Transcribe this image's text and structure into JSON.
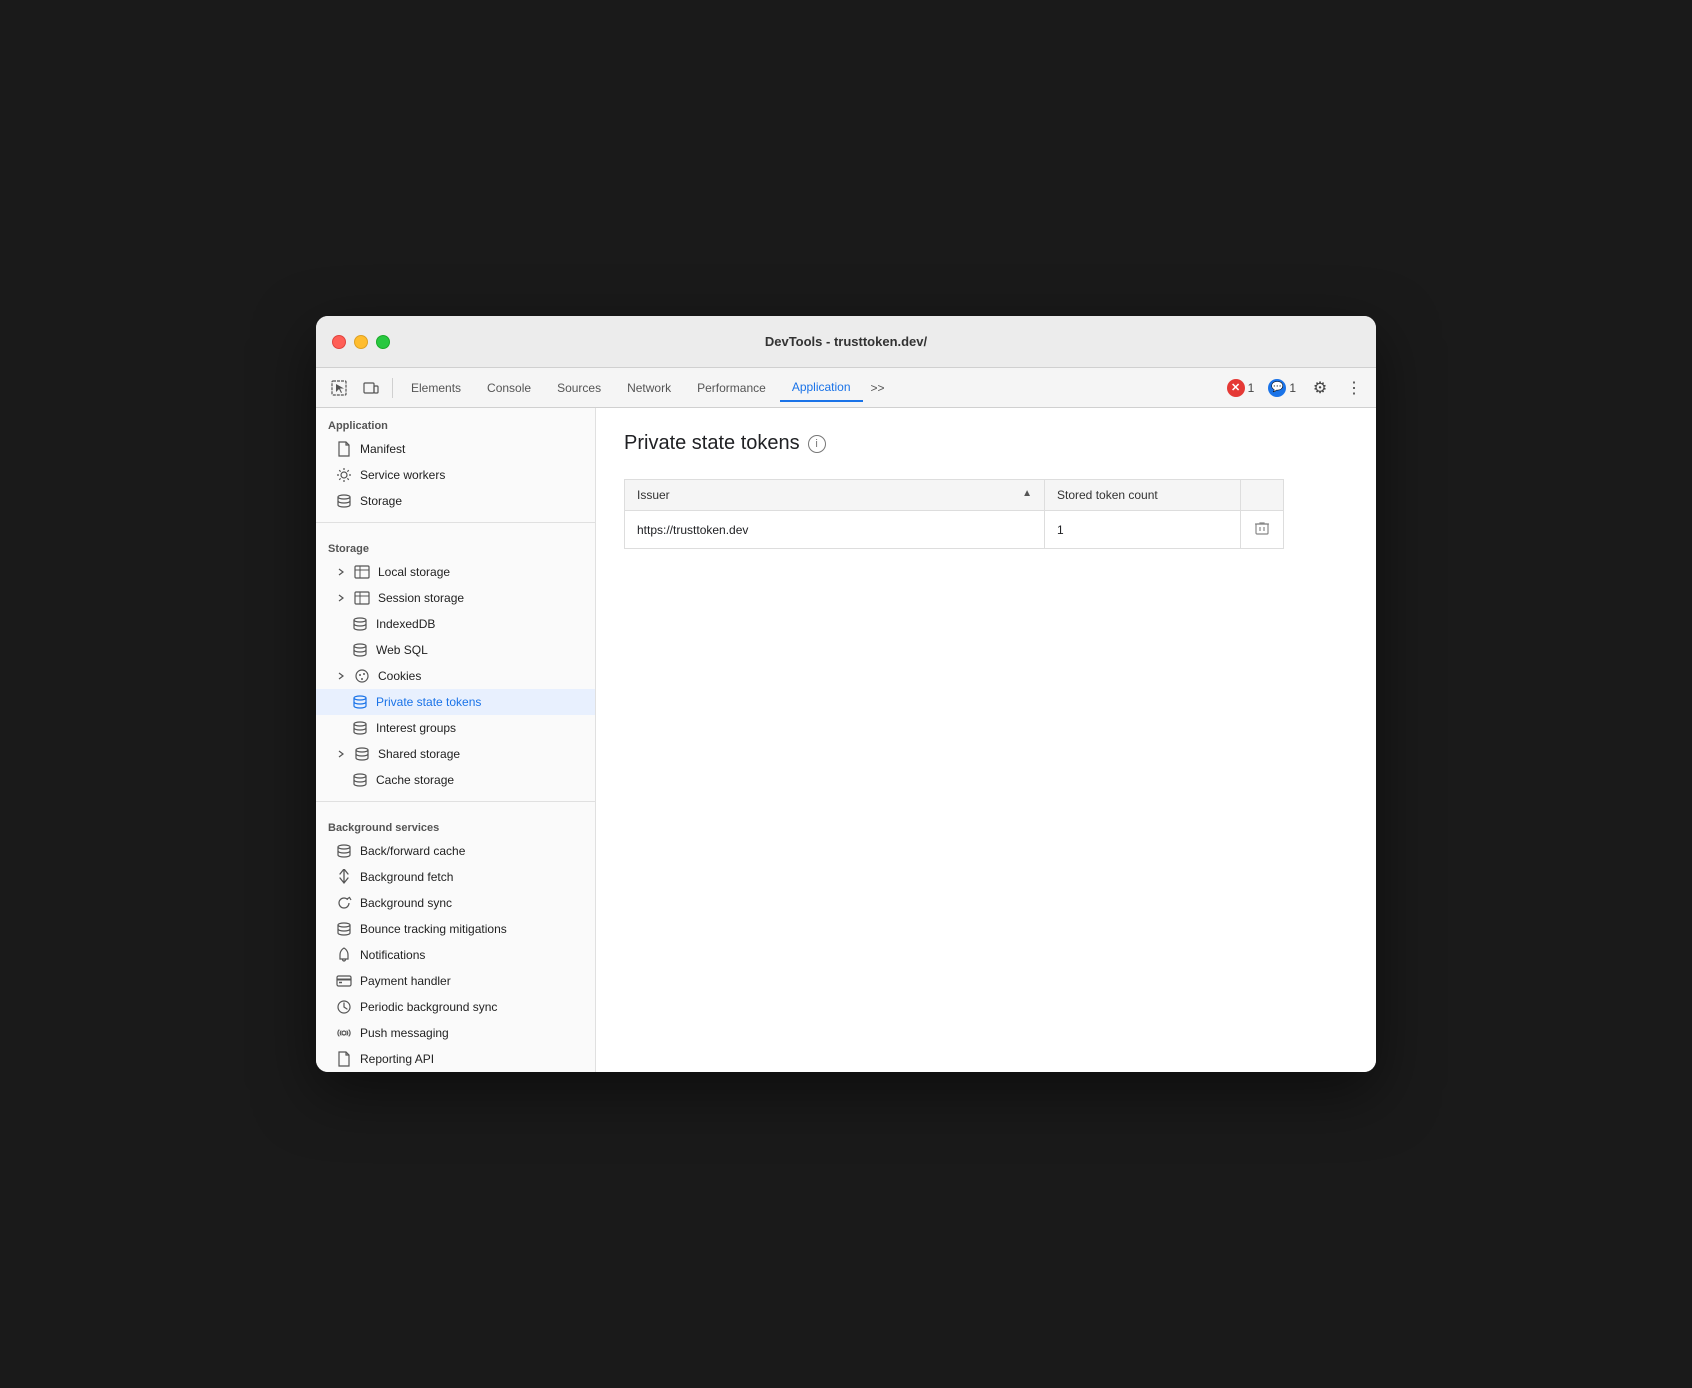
{
  "window": {
    "title": "DevTools - trusttoken.dev/"
  },
  "toolbar": {
    "tabs": [
      {
        "id": "elements",
        "label": "Elements",
        "active": false
      },
      {
        "id": "console",
        "label": "Console",
        "active": false
      },
      {
        "id": "sources",
        "label": "Sources",
        "active": false
      },
      {
        "id": "network",
        "label": "Network",
        "active": false
      },
      {
        "id": "performance",
        "label": "Performance",
        "active": false
      },
      {
        "id": "application",
        "label": "Application",
        "active": true
      }
    ],
    "more_label": ">>",
    "error_count": "1",
    "warning_count": "1"
  },
  "sidebar": {
    "application_section": "Application",
    "items_application": [
      {
        "id": "manifest",
        "label": "Manifest",
        "icon": "file-icon",
        "indented": true
      },
      {
        "id": "service-workers",
        "label": "Service workers",
        "icon": "gear-icon",
        "indented": true
      },
      {
        "id": "storage",
        "label": "Storage",
        "icon": "database-icon",
        "indented": true
      }
    ],
    "storage_section": "Storage",
    "items_storage": [
      {
        "id": "local-storage",
        "label": "Local storage",
        "icon": "table-icon",
        "indented": true,
        "has_arrow": true,
        "arrow_expanded": false
      },
      {
        "id": "session-storage",
        "label": "Session storage",
        "icon": "table-icon",
        "indented": true,
        "has_arrow": true,
        "arrow_expanded": false
      },
      {
        "id": "indexeddb",
        "label": "IndexedDB",
        "icon": "database-icon",
        "indented": true,
        "has_arrow": false
      },
      {
        "id": "web-sql",
        "label": "Web SQL",
        "icon": "database-icon",
        "indented": true,
        "has_arrow": false
      },
      {
        "id": "cookies",
        "label": "Cookies",
        "icon": "cookie-icon",
        "indented": true,
        "has_arrow": true,
        "arrow_expanded": false
      },
      {
        "id": "private-state-tokens",
        "label": "Private state tokens",
        "icon": "database-icon",
        "indented": true,
        "has_arrow": false,
        "active": true
      },
      {
        "id": "interest-groups",
        "label": "Interest groups",
        "icon": "database-icon",
        "indented": true,
        "has_arrow": false
      },
      {
        "id": "shared-storage",
        "label": "Shared storage",
        "icon": "database-icon",
        "indented": true,
        "has_arrow": true,
        "arrow_expanded": false
      },
      {
        "id": "cache-storage",
        "label": "Cache storage",
        "icon": "database-icon",
        "indented": true,
        "has_arrow": false
      }
    ],
    "background_section": "Background services",
    "items_background": [
      {
        "id": "backforward-cache",
        "label": "Back/forward cache",
        "icon": "database-icon"
      },
      {
        "id": "background-fetch",
        "label": "Background fetch",
        "icon": "fetch-icon"
      },
      {
        "id": "background-sync",
        "label": "Background sync",
        "icon": "sync-icon"
      },
      {
        "id": "bounce-tracking",
        "label": "Bounce tracking mitigations",
        "icon": "database-icon"
      },
      {
        "id": "notifications",
        "label": "Notifications",
        "icon": "bell-icon"
      },
      {
        "id": "payment-handler",
        "label": "Payment handler",
        "icon": "payment-icon"
      },
      {
        "id": "periodic-background-sync",
        "label": "Periodic background sync",
        "icon": "clock-icon"
      },
      {
        "id": "push-messaging",
        "label": "Push messaging",
        "icon": "cloud-icon"
      },
      {
        "id": "reporting-api",
        "label": "Reporting API",
        "icon": "file-icon"
      }
    ]
  },
  "main": {
    "title": "Private state tokens",
    "table": {
      "columns": [
        {
          "id": "issuer",
          "label": "Issuer",
          "sortable": true
        },
        {
          "id": "token-count",
          "label": "Stored token count",
          "sortable": false
        },
        {
          "id": "actions",
          "label": "",
          "sortable": false
        }
      ],
      "rows": [
        {
          "issuer": "https://trusttoken.dev",
          "token_count": "1"
        }
      ]
    }
  }
}
